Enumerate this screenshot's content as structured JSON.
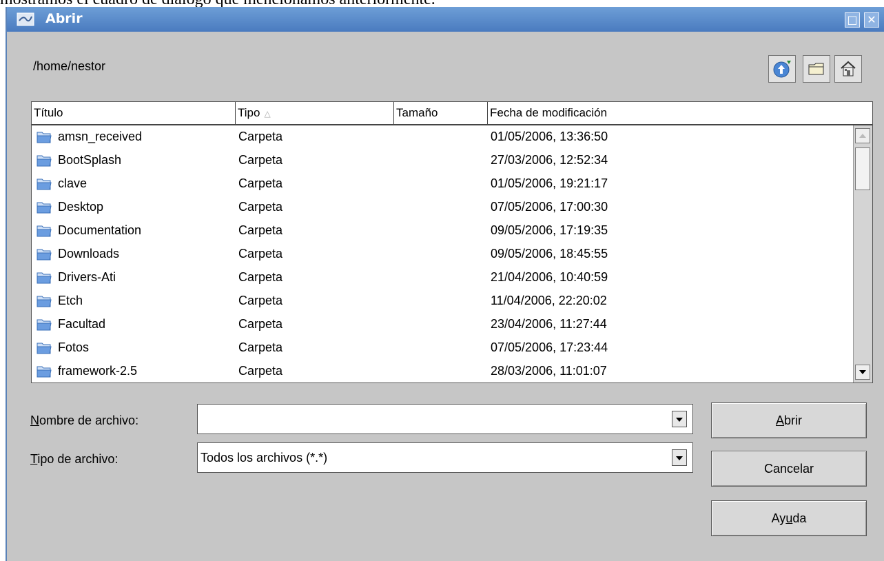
{
  "doc_line": "mostramos el cuadro de diálogo que mencionamos anteriormente.",
  "window": {
    "title": "Abrir",
    "maximize_glyph": "□",
    "close_glyph": "✕"
  },
  "location": {
    "path": "/home/nestor"
  },
  "toolbar": {
    "icons": [
      "up-folder-icon",
      "new-folder-icon",
      "home-icon"
    ]
  },
  "columns": {
    "title": "Título",
    "type": "Tipo",
    "size": "Tamaño",
    "modified": "Fecha de modificación",
    "sort_indicator": "△"
  },
  "files": [
    {
      "name": "amsn_received",
      "type": "Carpeta",
      "modified": "01/05/2006, 13:36:50"
    },
    {
      "name": "BootSplash",
      "type": "Carpeta",
      "modified": "27/03/2006, 12:52:34"
    },
    {
      "name": "clave",
      "type": "Carpeta",
      "modified": "01/05/2006, 19:21:17"
    },
    {
      "name": "Desktop",
      "type": "Carpeta",
      "modified": "07/05/2006, 17:00:30"
    },
    {
      "name": "Documentation",
      "type": "Carpeta",
      "modified": "09/05/2006, 17:19:35"
    },
    {
      "name": "Downloads",
      "type": "Carpeta",
      "modified": "09/05/2006, 18:45:55"
    },
    {
      "name": "Drivers-Ati",
      "type": "Carpeta",
      "modified": "21/04/2006, 10:40:59"
    },
    {
      "name": "Etch",
      "type": "Carpeta",
      "modified": "11/04/2006, 22:20:02"
    },
    {
      "name": "Facultad",
      "type": "Carpeta",
      "modified": "23/04/2006, 11:27:44"
    },
    {
      "name": "Fotos",
      "type": "Carpeta",
      "modified": "07/05/2006, 17:23:44"
    },
    {
      "name": "framework-2.5",
      "type": "Carpeta",
      "modified": "28/03/2006, 11:01:07"
    }
  ],
  "filename_field": {
    "label_mnemonic": "N",
    "label_rest": "ombre de archivo:",
    "value": ""
  },
  "filetype_field": {
    "label_mnemonic": "T",
    "label_rest": "ipo de archivo:",
    "value": "Todos los archivos (*.*)"
  },
  "buttons": {
    "open_mnemonic": "A",
    "open_rest": "brir",
    "cancel": "Cancelar",
    "help_pre": "Ay",
    "help_mnemonic": "u",
    "help_post": "da"
  },
  "colors": {
    "titlebar": "#5a8cc9",
    "dialog_bg": "#c6c6c6",
    "folder_icon": "#5b8fd6"
  }
}
